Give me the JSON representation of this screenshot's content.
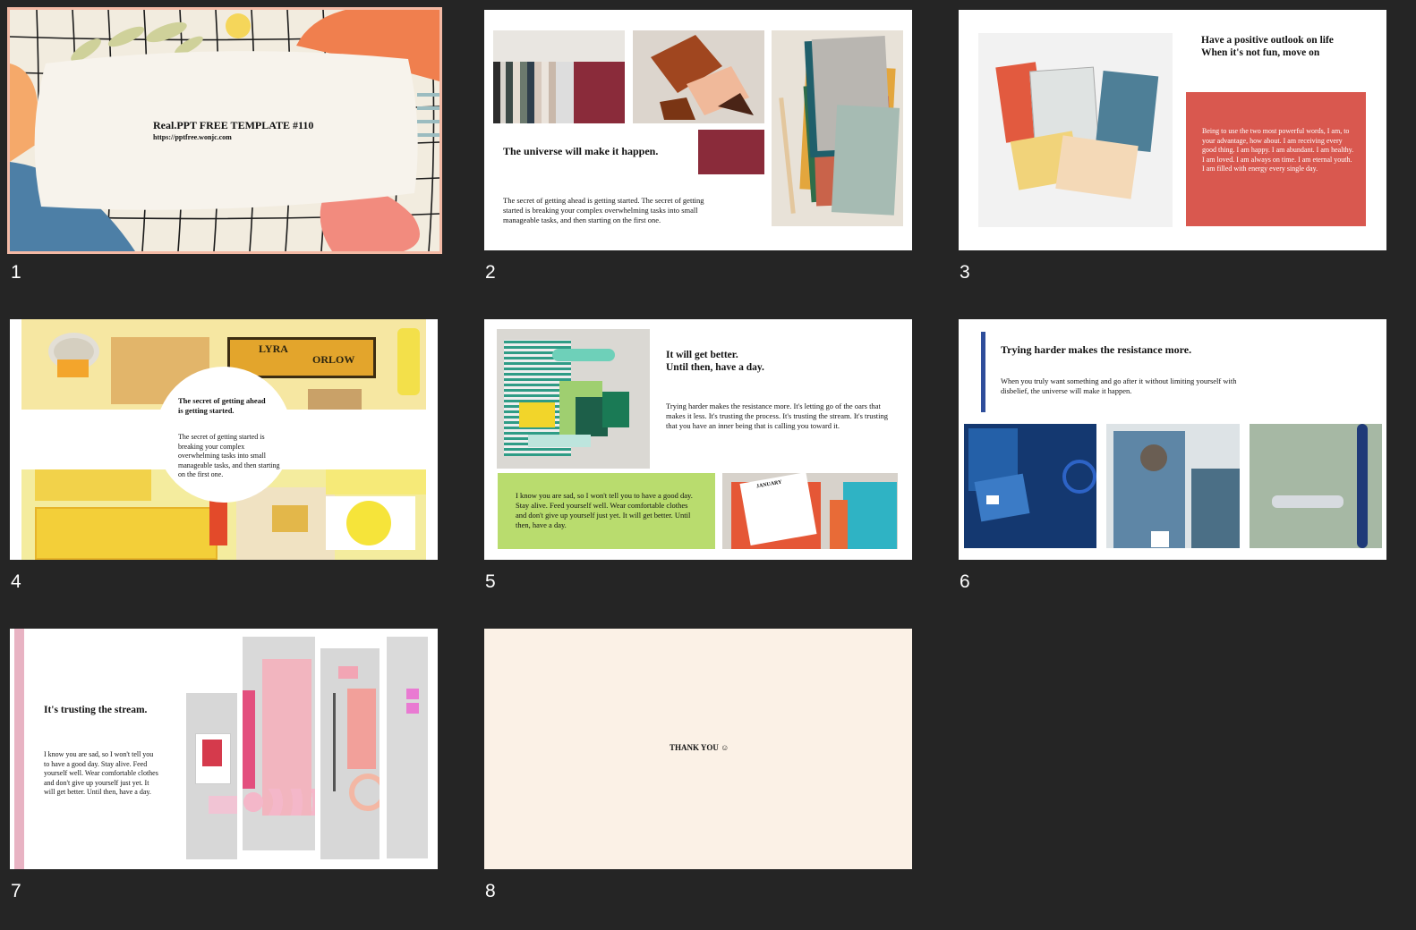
{
  "thumbnails": [
    {
      "number": "1",
      "title": "Real.PPT FREE TEMPLATE #110",
      "url": "https://pptfree.wonjc.com"
    },
    {
      "number": "2",
      "title": "The universe will make it happen.",
      "body": "The secret of getting ahead is getting started. The secret of getting started is breaking your complex overwhelming tasks into small manageable tasks, and then starting on the first one."
    },
    {
      "number": "3",
      "title_line1": "Have a positive outlook on life",
      "title_line2": "When it's not fun, move on",
      "body": "Being to use the two most powerful words, I am, to your advantage, how about. I am receiving every good thing. I am happy. I am abundant. I am healthy. I am loved. I am always on time. I am eternal youth. I am filled with energy every single day."
    },
    {
      "number": "4",
      "title": "The secret of getting ahead is getting started.",
      "body": "The secret of getting started is breaking your complex overwhelming tasks into small manageable tasks, and then starting on the first one.",
      "photo_text_brand": "LYRA",
      "photo_text_brand2": "ORLOW"
    },
    {
      "number": "5",
      "title_line1": "It will get better.",
      "title_line2": "Until then, have a day.",
      "body": "Trying harder makes the resistance more. It's letting go of the oars that makes it less. It's trusting the process. It's trusting the stream. It's trusting that you have an inner being that is calling you toward it.",
      "green_box": "I know you are sad, so I won't tell you to have a good day. Stay alive. Feed yourself well. Wear comfortable clothes and don't give up yourself just yet. It will get better. Until then, have a day.",
      "calendar_label": "JANUARY"
    },
    {
      "number": "6",
      "title": "Trying harder makes the resistance more.",
      "body": "When you truly want something and go after it without limiting yourself with disbelief, the universe will make it happen."
    },
    {
      "number": "7",
      "title": "It's trusting the stream.",
      "body": "I know you are sad, so I won't tell you to have a good day. Stay alive. Feed yourself well. Wear comfortable clothes and don't give up yourself just yet. It will get better. Until then, have a day."
    },
    {
      "number": "8",
      "text": "THANK YOU ☺"
    }
  ],
  "colors": {
    "background": "#252525",
    "selected_border": "#f3b9a4",
    "slide3_red": "#d9584f",
    "slide5_green": "#b9dc6e",
    "slide6_blue": "#2f4e9b",
    "slide7_pink": "#e8b3c3",
    "slide8_cream": "#fbf1e6",
    "maroon": "#8a2b3a"
  }
}
